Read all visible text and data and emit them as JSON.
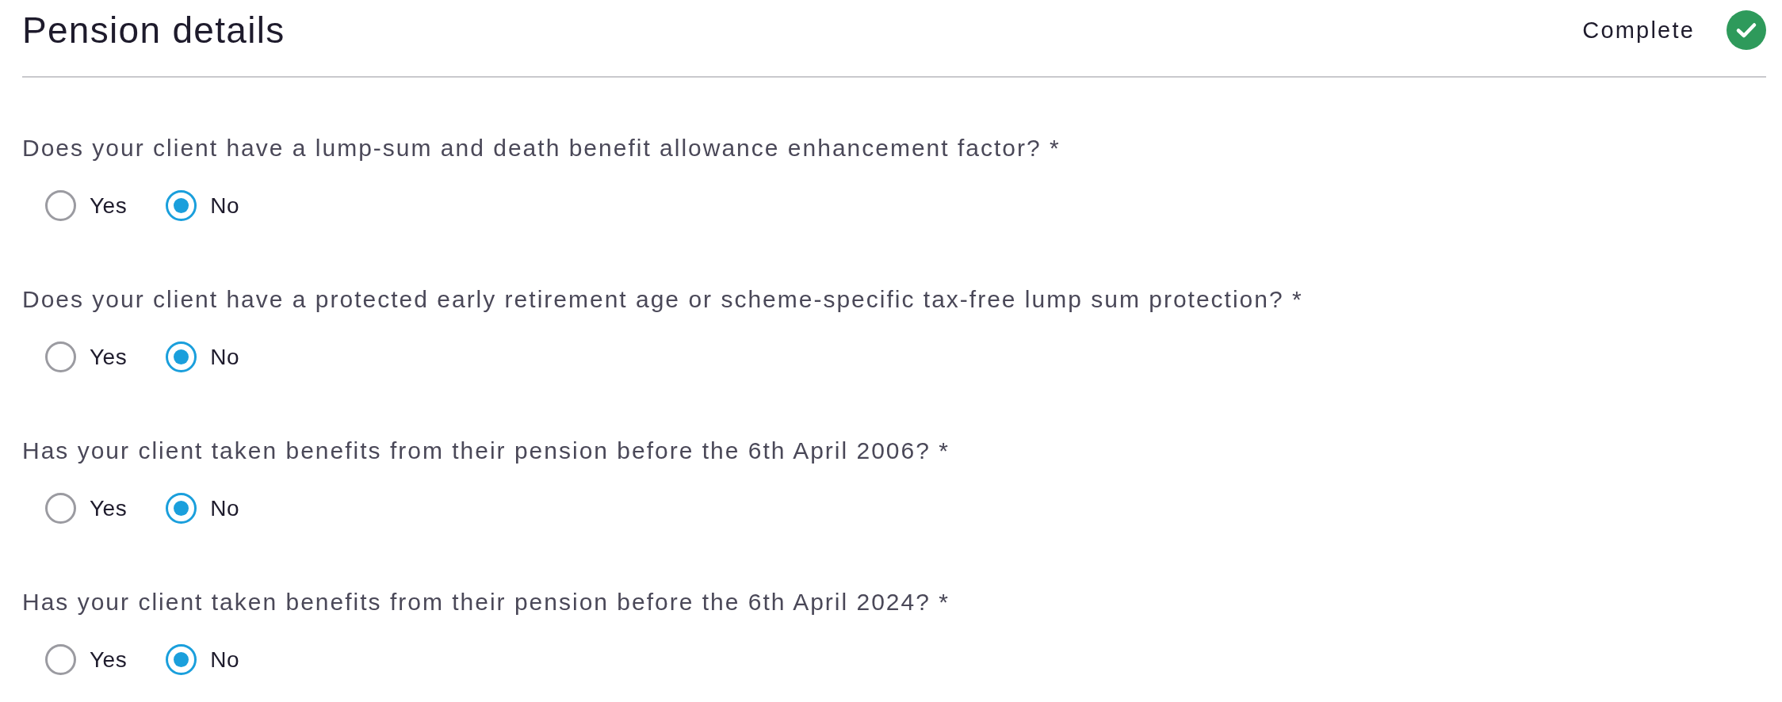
{
  "header": {
    "title": "Pension details",
    "status": {
      "label": "Complete",
      "complete": true
    }
  },
  "questions": [
    {
      "text": "Does your client have a lump-sum and death benefit allowance enhancement factor?",
      "required_mark": "*",
      "options": [
        {
          "label": "Yes",
          "selected": false
        },
        {
          "label": "No",
          "selected": true
        }
      ]
    },
    {
      "text": "Does your client have a protected early retirement age or scheme-specific tax-free lump sum protection?",
      "required_mark": "*",
      "options": [
        {
          "label": "Yes",
          "selected": false
        },
        {
          "label": "No",
          "selected": true
        }
      ]
    },
    {
      "text": "Has your client taken benefits from their pension before the 6th April 2006?",
      "required_mark": "*",
      "options": [
        {
          "label": "Yes",
          "selected": false
        },
        {
          "label": "No",
          "selected": true
        }
      ]
    },
    {
      "text": "Has your client taken benefits from their pension before the 6th April 2024?",
      "required_mark": "*",
      "options": [
        {
          "label": "Yes",
          "selected": false
        },
        {
          "label": "No",
          "selected": true
        }
      ]
    }
  ]
}
